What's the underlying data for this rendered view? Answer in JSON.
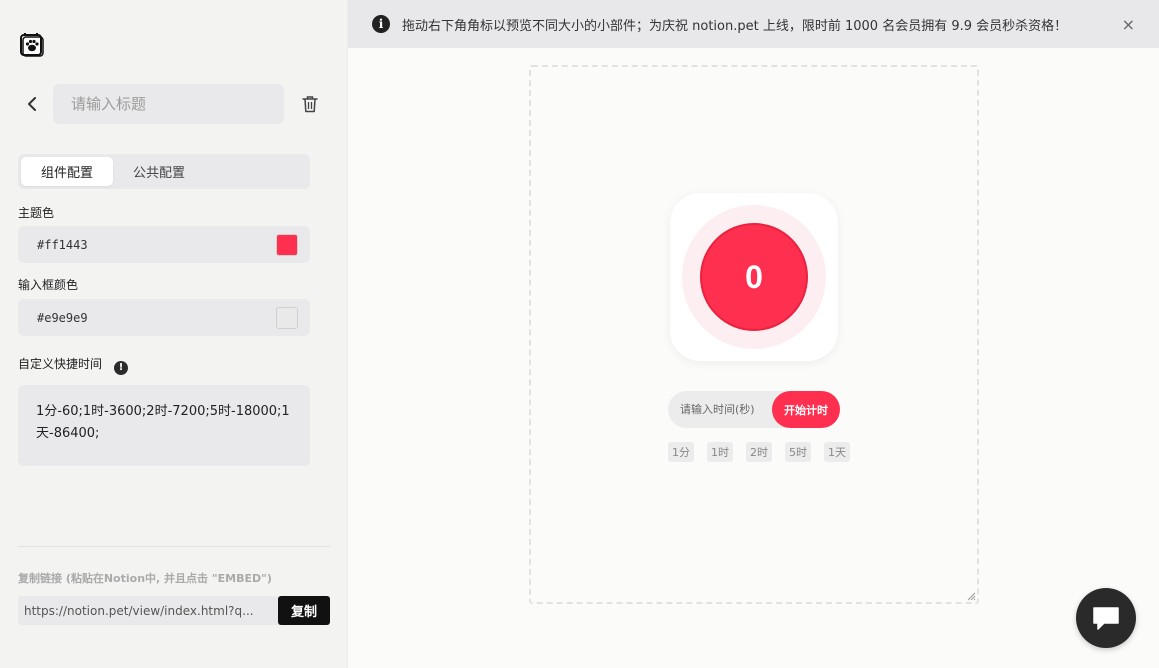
{
  "sidebar": {
    "title_placeholder": "请输入标题",
    "tabs": [
      {
        "label": "组件配置",
        "active": true
      },
      {
        "label": "公共配置",
        "active": false
      }
    ],
    "theme_color": {
      "label": "主题色",
      "value": "#ff1443",
      "swatch": "#ff2f4f"
    },
    "input_color": {
      "label": "输入框颜色",
      "value": "#e9e9e9",
      "swatch": "#e9e9e9"
    },
    "quick_time": {
      "label": "自定义快捷时间",
      "value": "1分-60;1时-3600;2时-7200;5时-18000;1天-86400;"
    },
    "copy_hint": "复制链接 (粘贴在Notion中, 并且点击 \"EMBED\")",
    "url": "https://notion.pet/view/index.html?q...",
    "copy_label": "复制"
  },
  "banner": {
    "text": "拖动右下角角标以预览不同大小的小部件；为庆祝 notion.pet 上线，限时前 1000 名会员拥有 9.9 会员秒杀资格！",
    "close": "×",
    "info": "i"
  },
  "widget": {
    "count": "0",
    "time_placeholder": "请输入时间(秒)",
    "start_label": "开始计时",
    "chips": [
      "1分",
      "1时",
      "2时",
      "5时",
      "1天"
    ]
  }
}
